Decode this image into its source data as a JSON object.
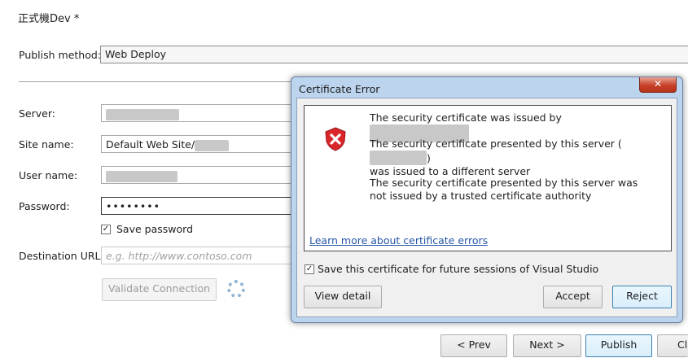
{
  "profile_title": "正式機Dev *",
  "publish_method": {
    "label": "Publish method:",
    "value": "Web Deploy"
  },
  "fields": {
    "server_label": "Server:",
    "site_name_label": "Site name:",
    "site_name_value": "Default Web Site/",
    "user_name_label": "User name:",
    "password_label": "Password:",
    "password_value": "••••••••",
    "save_password_label": "Save password",
    "destination_url_label": "Destination URL:",
    "destination_url_placeholder": "e.g. http://www.contoso.com"
  },
  "validate_button": "Validate Connection",
  "footer_buttons": {
    "prev": "< Prev",
    "next": "Next >",
    "publish": "Publish",
    "close": "Cl"
  },
  "dialog": {
    "title": "Certificate Error",
    "close_glyph": "✕",
    "msg1": "The security certificate was issued by",
    "msg2_a": "The security certificate presented by this server (",
    "msg2_b": ")",
    "msg2_c": "was issued to a different server",
    "msg3": "The security certificate presented by this server was not issued by a trusted certificate authority",
    "learn_more": "Learn more about certificate errors",
    "save_cert_label": "Save this certificate for future sessions of Visual Studio",
    "view_detail": "View detail",
    "accept": "Accept",
    "reject": "Reject"
  },
  "colors": {
    "error_red": "#d9262b",
    "accent_blue": "#3c7fb1",
    "link": "#2456a6"
  }
}
